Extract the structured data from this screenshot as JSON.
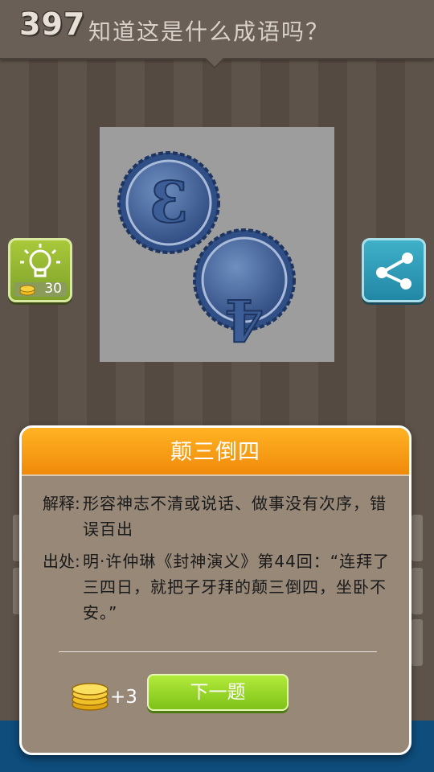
{
  "header": {
    "level": "397",
    "question": "知道这是什么成语吗？"
  },
  "hint": {
    "icon": "lightbulb-icon",
    "cost": "30"
  },
  "share": {
    "icon": "share-icon"
  },
  "puzzle": {
    "coin1_symbol": "3",
    "coin2_symbol": "4"
  },
  "dialog": {
    "title": "颠三倒四",
    "explanation_label": "解释:",
    "explanation_text": "形容神志不清或说话、做事没有次序，错误百出",
    "source_label": "出处:",
    "source_text": "明·许仲琳《封神演义》第44回：“连拜了三四日，就把子牙拜的颠三倒四，坐卧不安。”",
    "reward": "+3",
    "next_button": "下一题"
  },
  "colors": {
    "accent_orange": "#f5a010",
    "next_green": "#92d424",
    "hint_green": "#8db331",
    "share_blue": "#2d9cbb"
  }
}
